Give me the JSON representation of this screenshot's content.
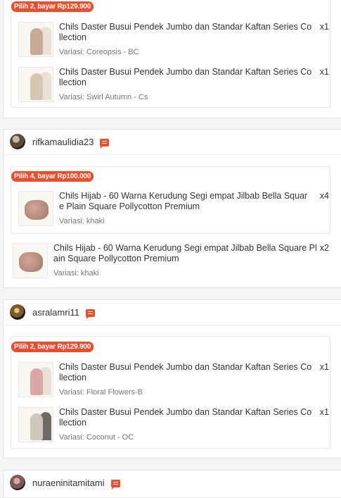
{
  "cards": [
    {
      "bundle": {
        "badge": "Pilih 2, bayar Rp129.900",
        "items": [
          {
            "name": "Chils Daster Busui Pendek Jumbo dan Standar Kaftan Series Co llection",
            "qty": "x1",
            "variation": "Variasi: Coreopsis - BC",
            "thumb_color": "#c9a998"
          },
          {
            "name": "Chils Daster Busui Pendek Jumbo dan Standar Kaftan Series Co llection",
            "qty": "x1",
            "variation": "Variasi: Swirl Autumn - Cs",
            "thumb_color": "#d7c6b1"
          }
        ]
      }
    },
    {
      "username": "rifkamaulidia23",
      "bundle": {
        "badge": "Pilih 4, bayar Rp100.000",
        "items": [
          {
            "name": "Chils Hijab - 60 Warna Kerudung Segi empat Jilbab Bella Squar e Plain Square Pollycotton Premium",
            "qty": "x4",
            "variation": "Variasi: khaki"
          }
        ]
      },
      "extra_item": {
        "name": "Chils Hijab - 60 Warna Kerudung Segi empat Jilbab Bella Square Pl ain Square Pollycotton Premium",
        "qty": "x2",
        "variation": "Variasi: khaki"
      }
    },
    {
      "username": "asralamri11",
      "bundle": {
        "badge": "Pilih 2, bayar Rp129.900",
        "items": [
          {
            "name": "Chils Daster Busui Pendek Jumbo dan Standar Kaftan Series Co llection",
            "qty": "x1",
            "variation": "Variasi: Floral Flowers-B",
            "thumb_color": "#d9a7a6"
          },
          {
            "name": "Chils Daster Busui Pendek Jumbo dan Standar Kaftan Series Co llection",
            "qty": "x1",
            "variation": "Variasi: Coconut - OC",
            "thumb_color": "#cfc6bc"
          }
        ]
      }
    },
    {
      "username": "nuraeninitamitami"
    }
  ]
}
